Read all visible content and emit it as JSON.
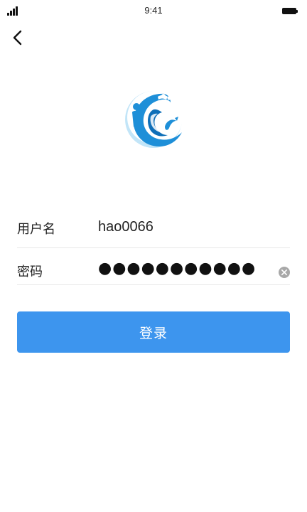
{
  "status_bar": {
    "time": "9:41"
  },
  "icons": {
    "signal": "signal-strength-icon",
    "battery": "battery-icon",
    "back": "chevron-left-icon",
    "logo": "wave-logo-icon",
    "clear": "clear-circle-icon"
  },
  "form": {
    "username_label": "用户名",
    "username_value": "hao0066",
    "password_label": "密码",
    "password_masked": "●●●●●●●●●●●"
  },
  "login_button": {
    "label": "登录"
  },
  "colors": {
    "primary": "#3d95ee",
    "logo_blue": "#1e8fd8",
    "logo_light": "#7cc7ef",
    "divider": "#e7e7e7",
    "clear_icon": "#a8a8a8"
  }
}
